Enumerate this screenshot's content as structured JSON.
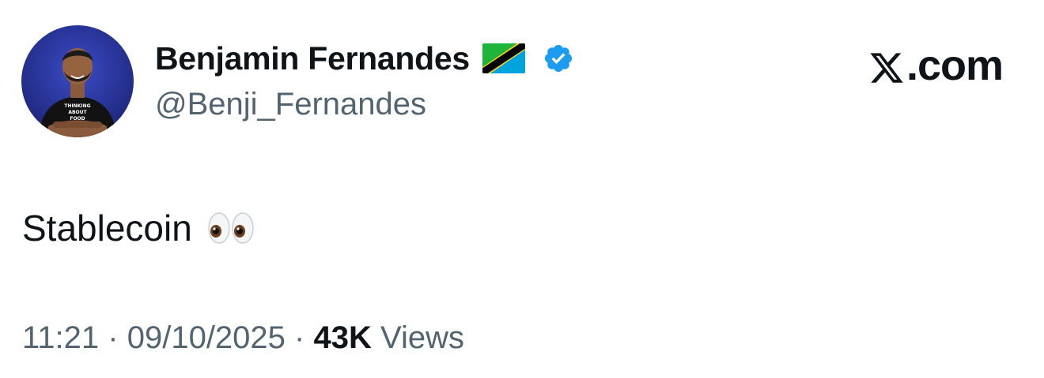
{
  "author": {
    "display_name": "Benjamin Fernandes",
    "handle": "@Benji_Fernandes",
    "avatar_shirt_text": "THINKING ABOUT FOOD",
    "flag_icon": "tanzania-flag-icon",
    "verified_icon": "verified-badge-icon",
    "verified_color": "#1d9bf0"
  },
  "brand": {
    "label": ".com",
    "logo_icon": "x-logo-icon"
  },
  "tweet": {
    "text": "Stablecoin",
    "emoji_icon": "eyes-emoji-icon"
  },
  "meta": {
    "time": "11:21",
    "separator": "·",
    "date": "09/10/2025",
    "views_count": "43K",
    "views_label": "Views"
  },
  "colors": {
    "text_primary": "#0f1419",
    "text_secondary": "#536471",
    "background": "#ffffff"
  }
}
